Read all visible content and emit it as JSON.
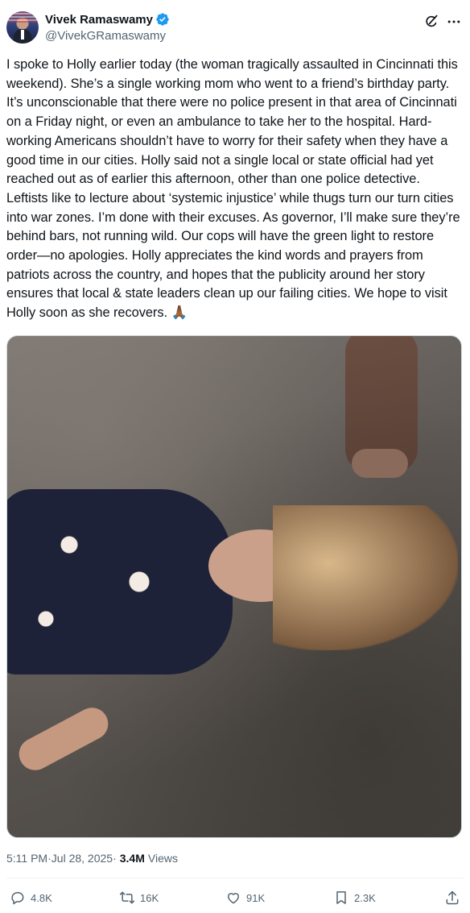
{
  "author": {
    "name": "Vivek Ramaswamy",
    "handle": "@VivekGRamaswamy",
    "verified": true
  },
  "tweet": {
    "text": "I spoke to Holly earlier today (the woman tragically assaulted in Cincinnati this weekend). She’s a single working mom who went to a friend’s birthday party. It’s unconscionable that there were no police present in that area of Cincinnati on a Friday night, or even an ambulance to take her to the hospital. Hard-working Americans shouldn’t have to worry for their safety when they have a good time in our cities. Holly said not a single local or state official had yet reached out as of earlier this afternoon, other than one police detective. Leftists like to lecture about ‘systemic injustice’ while thugs turn our turn cities into war zones. I’m done with their excuses. As governor, I’ll make sure they’re behind bars, not running wild. Our cops will have the green light to restore order—no apologies. Holly appreciates the kind words and prayers from patriots across the country, and hopes that the publicity around her story ensures that local & state leaders clean up our failing cities. We hope to visit Holly soon as she recovers. 🙏🏾"
  },
  "meta": {
    "time": "5:11 PM",
    "separator1": " · ",
    "date": "Jul 28, 2025",
    "separator2": " · ",
    "views_count": "3.4M",
    "views_label": "Views"
  },
  "actions": {
    "replies": "4.8K",
    "reposts": "16K",
    "likes": "91K",
    "bookmarks": "2.3K"
  },
  "colors": {
    "verified_badge": "#1d9bf0",
    "secondary_text": "#536471",
    "primary_text": "#0f1419"
  },
  "icons": [
    "grok-icon",
    "more-icon",
    "reply-icon",
    "repost-icon",
    "like-icon",
    "bookmark-icon",
    "share-icon"
  ]
}
